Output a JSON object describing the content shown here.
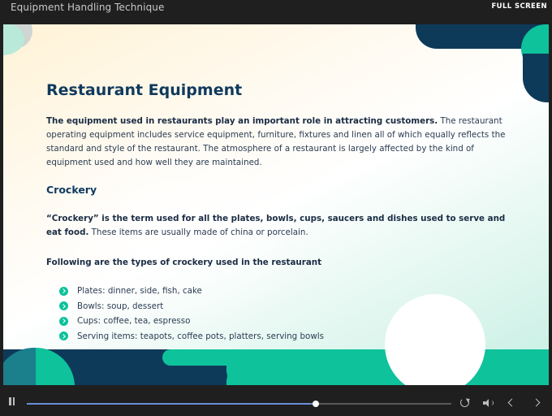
{
  "header": {
    "course_title": "Equipment Handling Technique",
    "fullscreen_label": "FULL SCREEN"
  },
  "slide": {
    "title": "Restaurant Equipment",
    "intro_bold": "The equipment used in restaurants play an important role in attracting customers.",
    "intro_rest": " The restaurant operating equipment includes service equipment, furniture, fixtures and linen all of which equally reflects the standard and style of the restaurant. The atmosphere of a restaurant is largely affected by the kind of equipment used and how well they are maintained.",
    "subheading": "Crockery",
    "crockery_bold": "“Crockery” is the term used for all the plates, bowls, cups, saucers and dishes used to serve and eat food.",
    "crockery_rest": " These items are usually made of china or porcelain.",
    "types_heading": "Following are the types of crockery used in the restaurant",
    "bullets": [
      "Plates: dinner, side, fish, cake",
      "Bowls: soup, dessert",
      "Cups: coffee, tea, espresso",
      "Serving items: teapots, coffee pots, platters, serving bowls"
    ]
  },
  "player": {
    "progress_fraction": 0.68,
    "icons": [
      "pause-icon",
      "replay-icon",
      "volume-icon",
      "chevron-left-icon",
      "chevron-right-icon"
    ]
  },
  "colors": {
    "navy": "#0e3a5a",
    "green": "#0ec29b",
    "teal": "#1b7f8c",
    "progress": "#6b8fd6"
  }
}
